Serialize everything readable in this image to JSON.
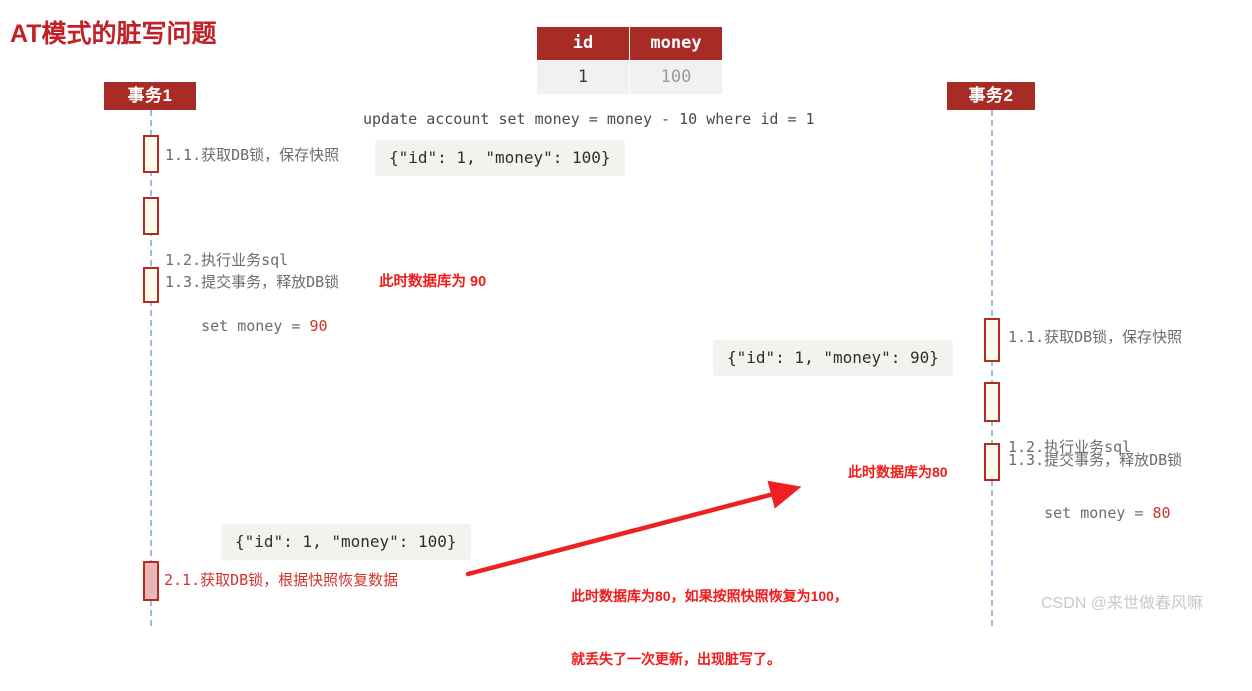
{
  "page": {
    "title": "AT模式的脏写问题",
    "title_color": "#c02026",
    "background": "#ffffff",
    "watermark": "CSDN @来世做春风嘛"
  },
  "db_table": {
    "columns": [
      "id",
      "money"
    ],
    "rows": [
      [
        "1",
        "100"
      ]
    ],
    "header_bg": "#a82b26",
    "row_bg": "#f1f1f1"
  },
  "sql": {
    "statement": "update account set money = money - 10 where id = 1"
  },
  "actors": [
    {
      "name": "transaction-1",
      "label": "事务1"
    },
    {
      "name": "transaction-2",
      "label": "事务2"
    }
  ],
  "transaction1": {
    "steps": [
      {
        "line1": "1.1.获取DB锁，保存快照",
        "line2": ""
      },
      {
        "line1": "1.2.执行业务sql",
        "line2": "    set money = ",
        "value": "90"
      },
      {
        "line1": "1.3.提交事务，释放DB锁",
        "line2": ""
      }
    ],
    "snapshot": "{\"id\": 1, \"money\": 100}",
    "db_state_note": "此时数据库为 90",
    "restore": {
      "label": "2.1.获取DB锁，根据快照恢复数据",
      "snapshot": "{\"id\": 1, \"money\": 100}"
    }
  },
  "transaction2": {
    "steps": [
      {
        "line1": "1.1.获取DB锁，保存快照",
        "line2": ""
      },
      {
        "line1": "1.2.执行业务sql",
        "line2": "    set money = ",
        "value": "80"
      },
      {
        "line1": "1.3.提交事务，释放DB锁",
        "line2": ""
      }
    ],
    "snapshot": "{\"id\": 1, \"money\": 90}",
    "db_state_note": "此时数据库为80"
  },
  "dirty_write_note": {
    "line1": "此时数据库为80，如果按照快照恢复为100，",
    "line2": "就丢失了一次更新，出现脏写了。"
  },
  "colors": {
    "brand_red": "#a82b26",
    "bright_red": "#f01b1b",
    "activation_fill": "#fdfced",
    "activation_border": "#b52b22",
    "restore_fill": "#e8b8b8",
    "lifeline": "#9dbbe0",
    "snapshot_bg": "#f1f4ee"
  }
}
